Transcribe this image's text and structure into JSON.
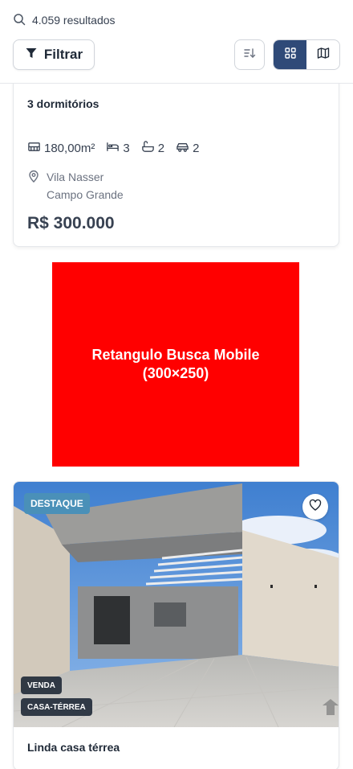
{
  "header": {
    "results_text": "4.059 resultados",
    "filter_label": "Filtrar"
  },
  "colors": {
    "accent": "#2f4a78",
    "ad_red": "#ff0000",
    "destaque": "#4a90b8"
  },
  "listing_1": {
    "title": "3 dormitórios",
    "area": "180,00m²",
    "bedrooms": "3",
    "bathrooms": "2",
    "parking": "2",
    "neighborhood": "Vila Nasser",
    "city": "Campo Grande",
    "price": "R$ 300.000"
  },
  "ad": {
    "line1": "Retangulo Busca Mobile",
    "line2": "(300×250)"
  },
  "listing_2": {
    "badge": "DESTAQUE",
    "tag_deal": "VENDA",
    "tag_type": "CASA-TÉRREA",
    "title": "Linda casa térrea"
  },
  "icons": [
    "search-icon",
    "filter-icon",
    "sort-icon",
    "grid-icon",
    "map-icon",
    "area-icon",
    "bed-icon",
    "bath-icon",
    "car-icon",
    "location-pin-icon",
    "heart-icon"
  ]
}
